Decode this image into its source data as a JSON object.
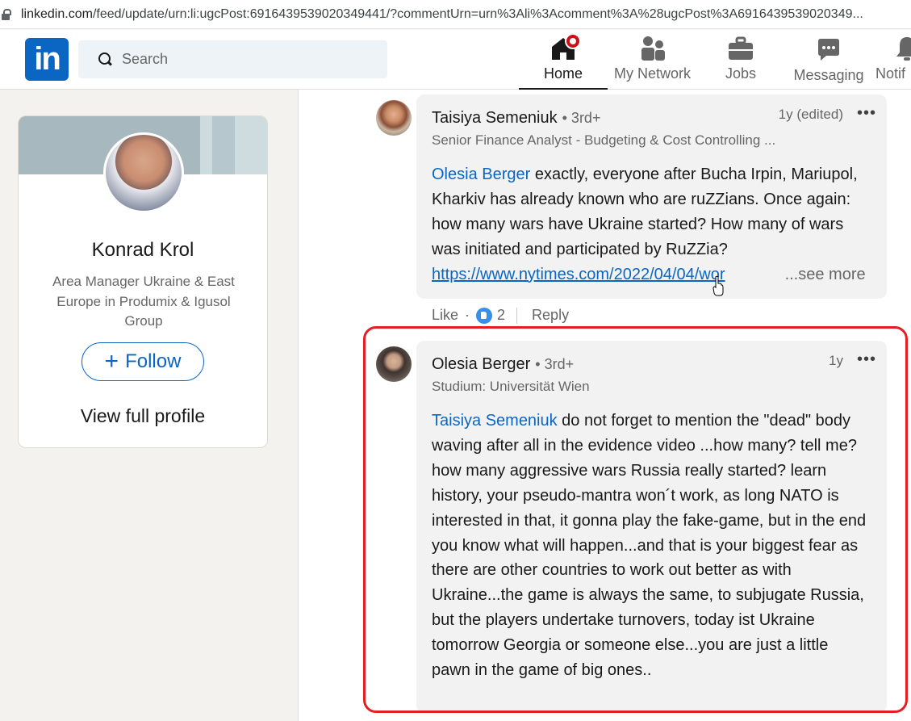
{
  "browser": {
    "url_host": "linkedin.com",
    "url_rest": "/feed/update/urn:li:ugcPost:6916439539020349441/?commentUrn=urn%3Ali%3Acomment%3A%28ugcPost%3A6916439539020349..."
  },
  "nav": {
    "logo_text": "in",
    "search_placeholder": "Search",
    "items": [
      {
        "label": "Home",
        "icon": "home-icon",
        "active": true
      },
      {
        "label": "My Network",
        "icon": "network-icon"
      },
      {
        "label": "Jobs",
        "icon": "briefcase-icon"
      },
      {
        "label": "Messaging",
        "icon": "messaging-icon"
      },
      {
        "label": "Notif",
        "icon": "bell-icon"
      }
    ]
  },
  "profile_card": {
    "name": "Konrad Krol",
    "headline": "Area Manager Ukraine & East Europe in Produmix & Igusol Group",
    "follow_label": "Follow",
    "view_profile_label": "View full profile"
  },
  "comments": [
    {
      "author": "Taisiya Semeniuk",
      "degree": "• 3rd+",
      "subtitle": "Senior Finance Analyst - Budgeting & Cost Controlling ...",
      "time": "1y (edited)",
      "mention": "Olesia Berger",
      "text": " exactly, everyone after Bucha Irpin, Mariupol, Kharkiv has already known who are ruZZians. Once again: how many wars have Ukraine started? How many of wars was initiated and participated by RuZZia?",
      "link": "https://www.nytimes.com/2022/04/04/wor",
      "see_more": "...see more",
      "actions": {
        "like": "Like",
        "dot": "·",
        "reaction_count": "2",
        "reply": "Reply"
      }
    },
    {
      "author": "Olesia Berger",
      "degree": "• 3rd+",
      "subtitle": "Studium: Universität Wien",
      "time": "1y",
      "mention": "Taisiya Semeniuk",
      "text": " do not forget to mention the \"dead\" body waving after all in the evidence video ...how many? tell me? how many aggressive wars Russia really started? learn history, your pseudo-mantra won´t work, as long NATO is interested in that, it gonna play the fake-game, but in the end you know what will happen...and that is your biggest fear as there are other countries to work out better as with Ukraine...the game is always the same, to subjugate Russia, but the players undertake turnovers, today ist Ukraine tomorrow Georgia or someone else...you are just a little pawn in the game of big ones.."
    }
  ],
  "colors": {
    "accent": "#0a66c2",
    "highlight_border": "#e31e24",
    "notification_badge": "#cc1016"
  }
}
